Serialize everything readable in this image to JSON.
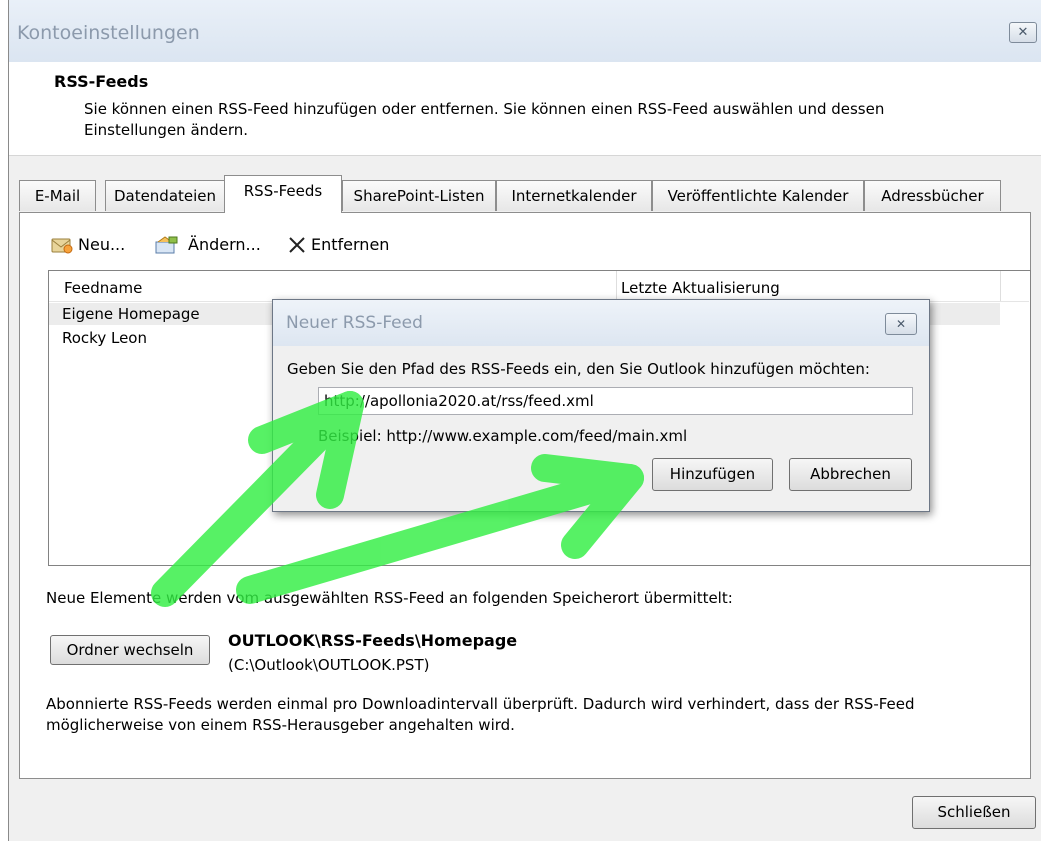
{
  "window": {
    "title": "Kontoeinstellungen",
    "close_glyph": "✕"
  },
  "header": {
    "title": "RSS-Feeds",
    "description": "Sie können einen RSS-Feed hinzufügen oder entfernen. Sie können einen RSS-Feed auswählen und dessen Einstellungen ändern."
  },
  "tabs": [
    {
      "label": "E-Mail"
    },
    {
      "label": "Datendateien"
    },
    {
      "label": "RSS-Feeds"
    },
    {
      "label": "SharePoint-Listen"
    },
    {
      "label": "Internetkalender"
    },
    {
      "label": "Veröffentlichte Kalender"
    },
    {
      "label": "Adressbücher"
    }
  ],
  "toolbar": {
    "new_label": "Neu...",
    "edit_label": "Ändern...",
    "remove_label": "Entfernen"
  },
  "feed_list": {
    "columns": [
      "Feedname",
      "Letzte Aktualisierung"
    ],
    "rows": [
      {
        "name": "Eigene Homepage"
      },
      {
        "name": "Rocky Leon"
      }
    ]
  },
  "delivery": {
    "text": "Neue Elemente werden vom ausgewählten RSS-Feed an folgenden Speicherort übermittelt:",
    "change_folder_label": "Ordner wechseln",
    "folder_path": "OUTLOOK\\RSS-Feeds\\Homepage",
    "file_path": "(C:\\Outlook\\OUTLOOK.PST)"
  },
  "info_text": "Abonnierte RSS-Feeds werden einmal pro Downloadintervall überprüft. Dadurch wird verhindert, dass der RSS-Feed möglicherweise von einem RSS-Herausgeber angehalten wird.",
  "close_button_label": "Schließen",
  "dialog": {
    "title": "Neuer RSS-Feed",
    "close_glyph": "✕",
    "prompt": "Geben Sie den Pfad des RSS-Feeds ein, den Sie Outlook hinzufügen möchten:",
    "url_value": "http://apollonia2020.at/rss/feed.xml",
    "example": "Beispiel: http://www.example.com/feed/main.xml",
    "add_label": "Hinzufügen",
    "cancel_label": "Abbrechen"
  },
  "colors": {
    "annotation_arrows": "#33ee44",
    "accent": "#dbe5f1"
  },
  "icons": {
    "new": "new-feed-icon",
    "edit": "edit-icon",
    "remove": "x-icon"
  }
}
